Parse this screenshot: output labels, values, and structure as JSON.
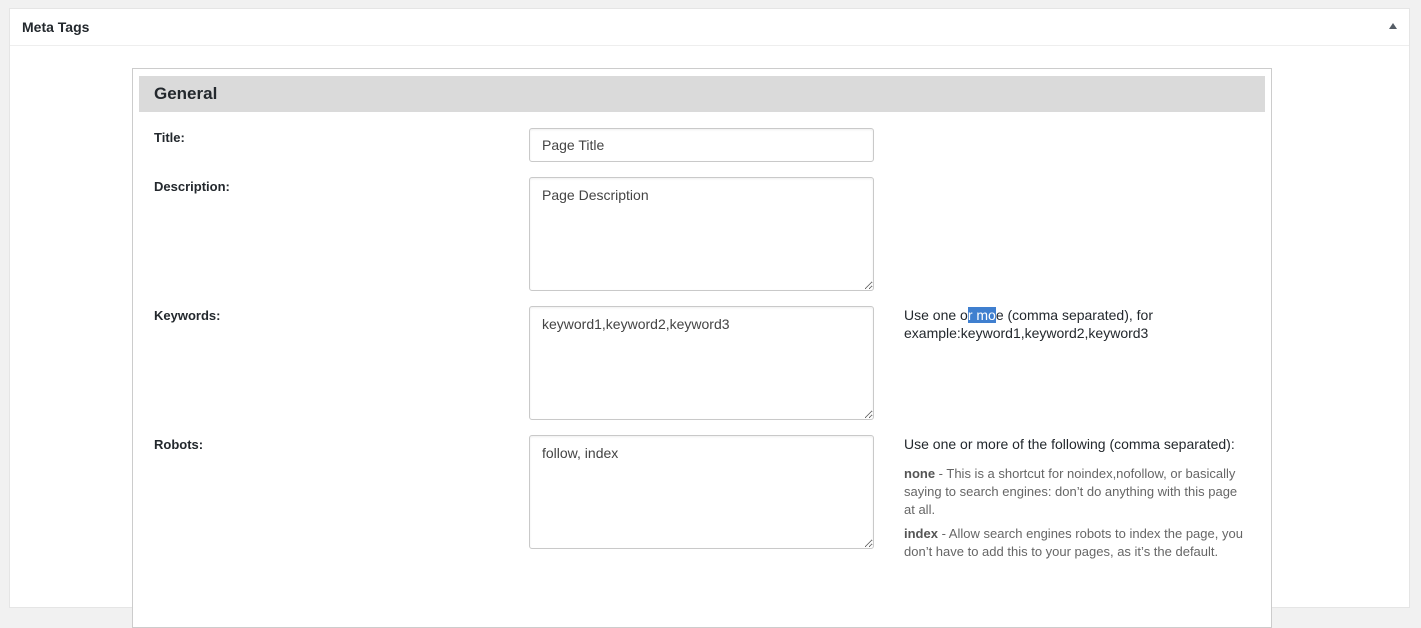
{
  "metabox": {
    "title": "Meta Tags",
    "toggle_icon": "triangle-up-icon"
  },
  "section": {
    "title": "General"
  },
  "fields": {
    "title": {
      "label": "Title:",
      "value": "Page Title"
    },
    "description": {
      "label": "Description:",
      "value": "Page Description"
    },
    "keywords": {
      "label": "Keywords:",
      "value": "keyword1,keyword2,keyword3",
      "help_pre": "Use one o",
      "help_selected": "r mo",
      "help_post": "e (comma separated), for example:keyword1,keyword2,keyword3"
    },
    "robots": {
      "label": "Robots:",
      "value": "follow, index",
      "help_intro": "Use one or more of the following (comma separated):",
      "options": [
        {
          "term": "none",
          "desc": " - This is a shortcut for noindex,nofollow, or basically saying to search engines: don’t do anything with this page at all."
        },
        {
          "term": "index",
          "desc": " - Allow search engines robots to index the page, you don’t have to add this to your pages, as it’s the default."
        }
      ]
    }
  },
  "colors": {
    "selection": "#3f7fcf",
    "section_header_bg": "#dadada"
  }
}
